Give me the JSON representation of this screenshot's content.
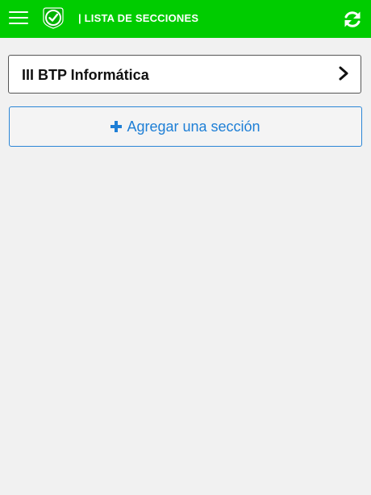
{
  "header": {
    "title": "| LISTA DE SECCIONES",
    "menu_icon": "hamburger-menu-icon",
    "logo_icon": "check-shield-logo-icon",
    "refresh_icon": "refresh-icon",
    "color": "#00cc00"
  },
  "sections": [
    {
      "label": "III BTP Informática",
      "icon": "chevron-right-icon"
    }
  ],
  "add_section": {
    "label": "Agregar una sección",
    "icon": "plus-icon",
    "color": "#1e7fd6"
  }
}
